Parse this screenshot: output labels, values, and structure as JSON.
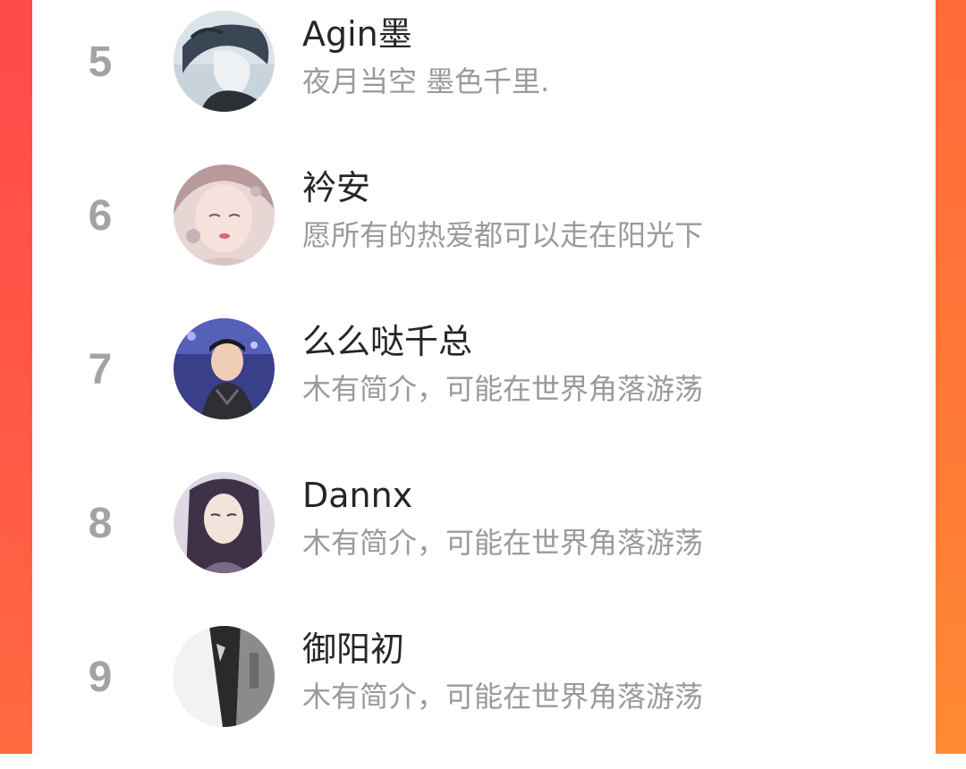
{
  "frame": {
    "accent_left": "#ff4a4a",
    "accent_right": "#ff7a36",
    "card_background": "#ffffff"
  },
  "colors": {
    "rank_number": "#a3a3a3",
    "name_text": "#262626",
    "bio_text": "#9a9a9a"
  },
  "ranking": {
    "items": [
      {
        "rank": "5",
        "name": "Agin墨",
        "bio": "夜月当空 墨色千里.",
        "avatar_icon": "avatar-anime-boy-icon"
      },
      {
        "rank": "6",
        "name": "衿安",
        "bio": "愿所有的热爱都可以走在阳光下",
        "avatar_icon": "avatar-anime-girl-icon"
      },
      {
        "rank": "7",
        "name": "么么哒千总",
        "bio": "木有简介，可能在世界角落游荡",
        "avatar_icon": "avatar-photo-boy-icon"
      },
      {
        "rank": "8",
        "name": "Dannx",
        "bio": "木有简介，可能在世界角落游荡",
        "avatar_icon": "avatar-anime-longhair-icon"
      },
      {
        "rank": "9",
        "name": "御阳初",
        "bio": "木有简介，可能在世界角落游荡",
        "avatar_icon": "avatar-photo-shirt-icon"
      }
    ]
  }
}
